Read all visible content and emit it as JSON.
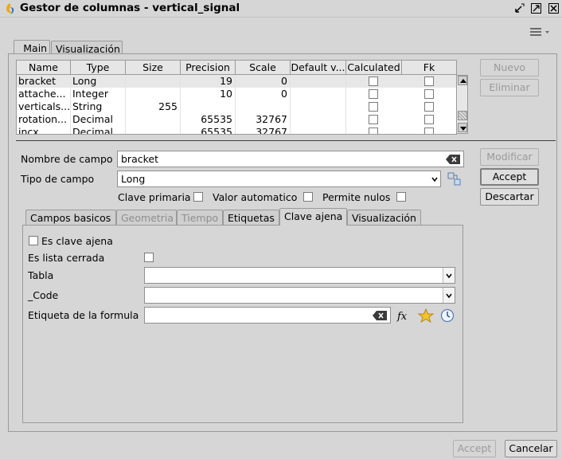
{
  "window": {
    "title": "Gestor de columnas - vertical_signal",
    "accent": "#e8a200"
  },
  "outer_tabs": [
    {
      "label": "_Main"
    },
    {
      "label": "Visualización"
    }
  ],
  "table": {
    "columns": [
      "Name",
      "Type",
      "Size",
      "Precision",
      "Scale",
      "Default v...",
      "Calculated",
      "Fk"
    ],
    "rows": [
      {
        "name": "bracket",
        "type": "Long",
        "size": "",
        "precision": "19",
        "scale": "0",
        "default": "",
        "calculated": false,
        "fk": false
      },
      {
        "name": "attache...",
        "type": "Integer",
        "size": "",
        "precision": "10",
        "scale": "0",
        "default": "",
        "calculated": false,
        "fk": false
      },
      {
        "name": "verticals...",
        "type": "String",
        "size": "255",
        "precision": "",
        "scale": "",
        "default": "",
        "calculated": false,
        "fk": false
      },
      {
        "name": "rotation...",
        "type": "Decimal",
        "size": "",
        "precision": "65535",
        "scale": "32767",
        "default": "",
        "calculated": false,
        "fk": false
      },
      {
        "name": "incx",
        "type": "Decimal",
        "size": "",
        "precision": "65535",
        "scale": "32767",
        "default": "",
        "calculated": false,
        "fk": false
      }
    ]
  },
  "side_buttons": {
    "nuevo": "Nuevo",
    "eliminar": "Eliminar",
    "modificar": "Modificar",
    "accept": "Accept",
    "descartar": "Descartar"
  },
  "form": {
    "nombre_label": "Nombre de campo",
    "nombre_value": "bracket",
    "tipo_label": "Tipo de campo",
    "tipo_value": "Long",
    "clave_primaria": "Clave primaria",
    "valor_automatico": "Valor automatico",
    "permite_nulos": "Permite nulos"
  },
  "inner_tabs": [
    {
      "label": "Campos basicos",
      "state": "normal"
    },
    {
      "label": "Geometria",
      "state": "disabled"
    },
    {
      "label": "Tiempo",
      "state": "disabled"
    },
    {
      "label": "Etiquetas",
      "state": "normal"
    },
    {
      "label": "Clave ajena",
      "state": "active"
    },
    {
      "label": "Visualización",
      "state": "normal"
    }
  ],
  "clave_ajena": {
    "es_clave_ajena": "Es clave ajena",
    "es_lista_cerrada": "Es lista cerrada",
    "tabla_label": "Tabla",
    "tabla_value": "",
    "code_label": "_Code",
    "code_value": "",
    "etiqueta_label": "Etiqueta de la formula",
    "etiqueta_value": ""
  },
  "footer": {
    "accept": "Accept",
    "cancelar": "Cancelar"
  }
}
